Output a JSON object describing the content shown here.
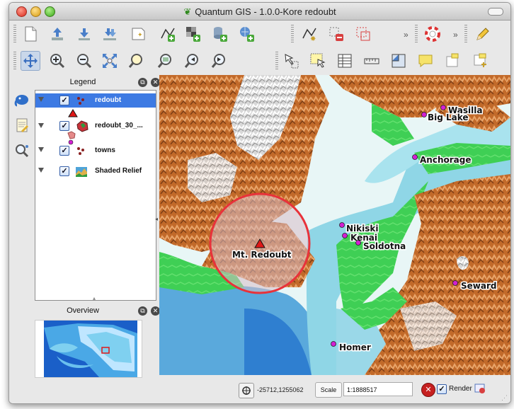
{
  "window": {
    "title": "Quantum GIS - 1.0.0-Kore  redoubt"
  },
  "toolbar1": {
    "items": [
      "new-project-icon",
      "open-project-icon",
      "save-project-icon",
      "save-as-icon",
      "new-print-composer-icon",
      "add-vector-layer-icon",
      "add-raster-layer-icon",
      "add-postgis-layer-icon",
      "add-wms-layer-icon",
      "capture-point-icon",
      "delete-feature-icon",
      "move-feature-icon",
      "help-icon",
      "edit-pencil-icon"
    ],
    "more": "»"
  },
  "toolbar2": {
    "items": [
      "pan-icon",
      "zoom-in-icon",
      "zoom-out-icon",
      "zoom-full-icon",
      "zoom-selection-icon",
      "zoom-layer-icon",
      "zoom-last-icon",
      "zoom-next-icon",
      "identify-icon",
      "select-features-icon",
      "attribute-table-icon",
      "measure-line-icon",
      "measure-area-icon",
      "map-tips-icon",
      "new-bookmark-icon",
      "show-bookmarks-icon"
    ],
    "more": "»"
  },
  "legend": {
    "title": "Legend",
    "layers": [
      {
        "name": "redoubt",
        "checked": true,
        "selected": true
      },
      {
        "name": "redoubt_30_...",
        "checked": true,
        "selected": false
      },
      {
        "name": "towns",
        "checked": true,
        "selected": false
      },
      {
        "name": "Shaded Relief",
        "checked": true,
        "selected": false
      }
    ]
  },
  "overview": {
    "title": "Overview"
  },
  "map": {
    "volcano_label": "Mt. Redoubt",
    "towns": [
      "Wasilla",
      "Big Lake",
      "Anchorage",
      "Nikiski",
      "Kenai",
      "Soldotna",
      "Seward",
      "Homer"
    ],
    "colors": {
      "water": "#8fd6e6",
      "lowland": "#3fcf55",
      "mountain": "#c5702b",
      "snow": "#f0f0f0",
      "town": "#d31fd3",
      "circle": "#e8323a"
    }
  },
  "status": {
    "coordinates": "-25712,1255062",
    "scale_label": "Scale",
    "scale_value": "1:1888517",
    "render_label": "Render",
    "render_checked": true
  }
}
